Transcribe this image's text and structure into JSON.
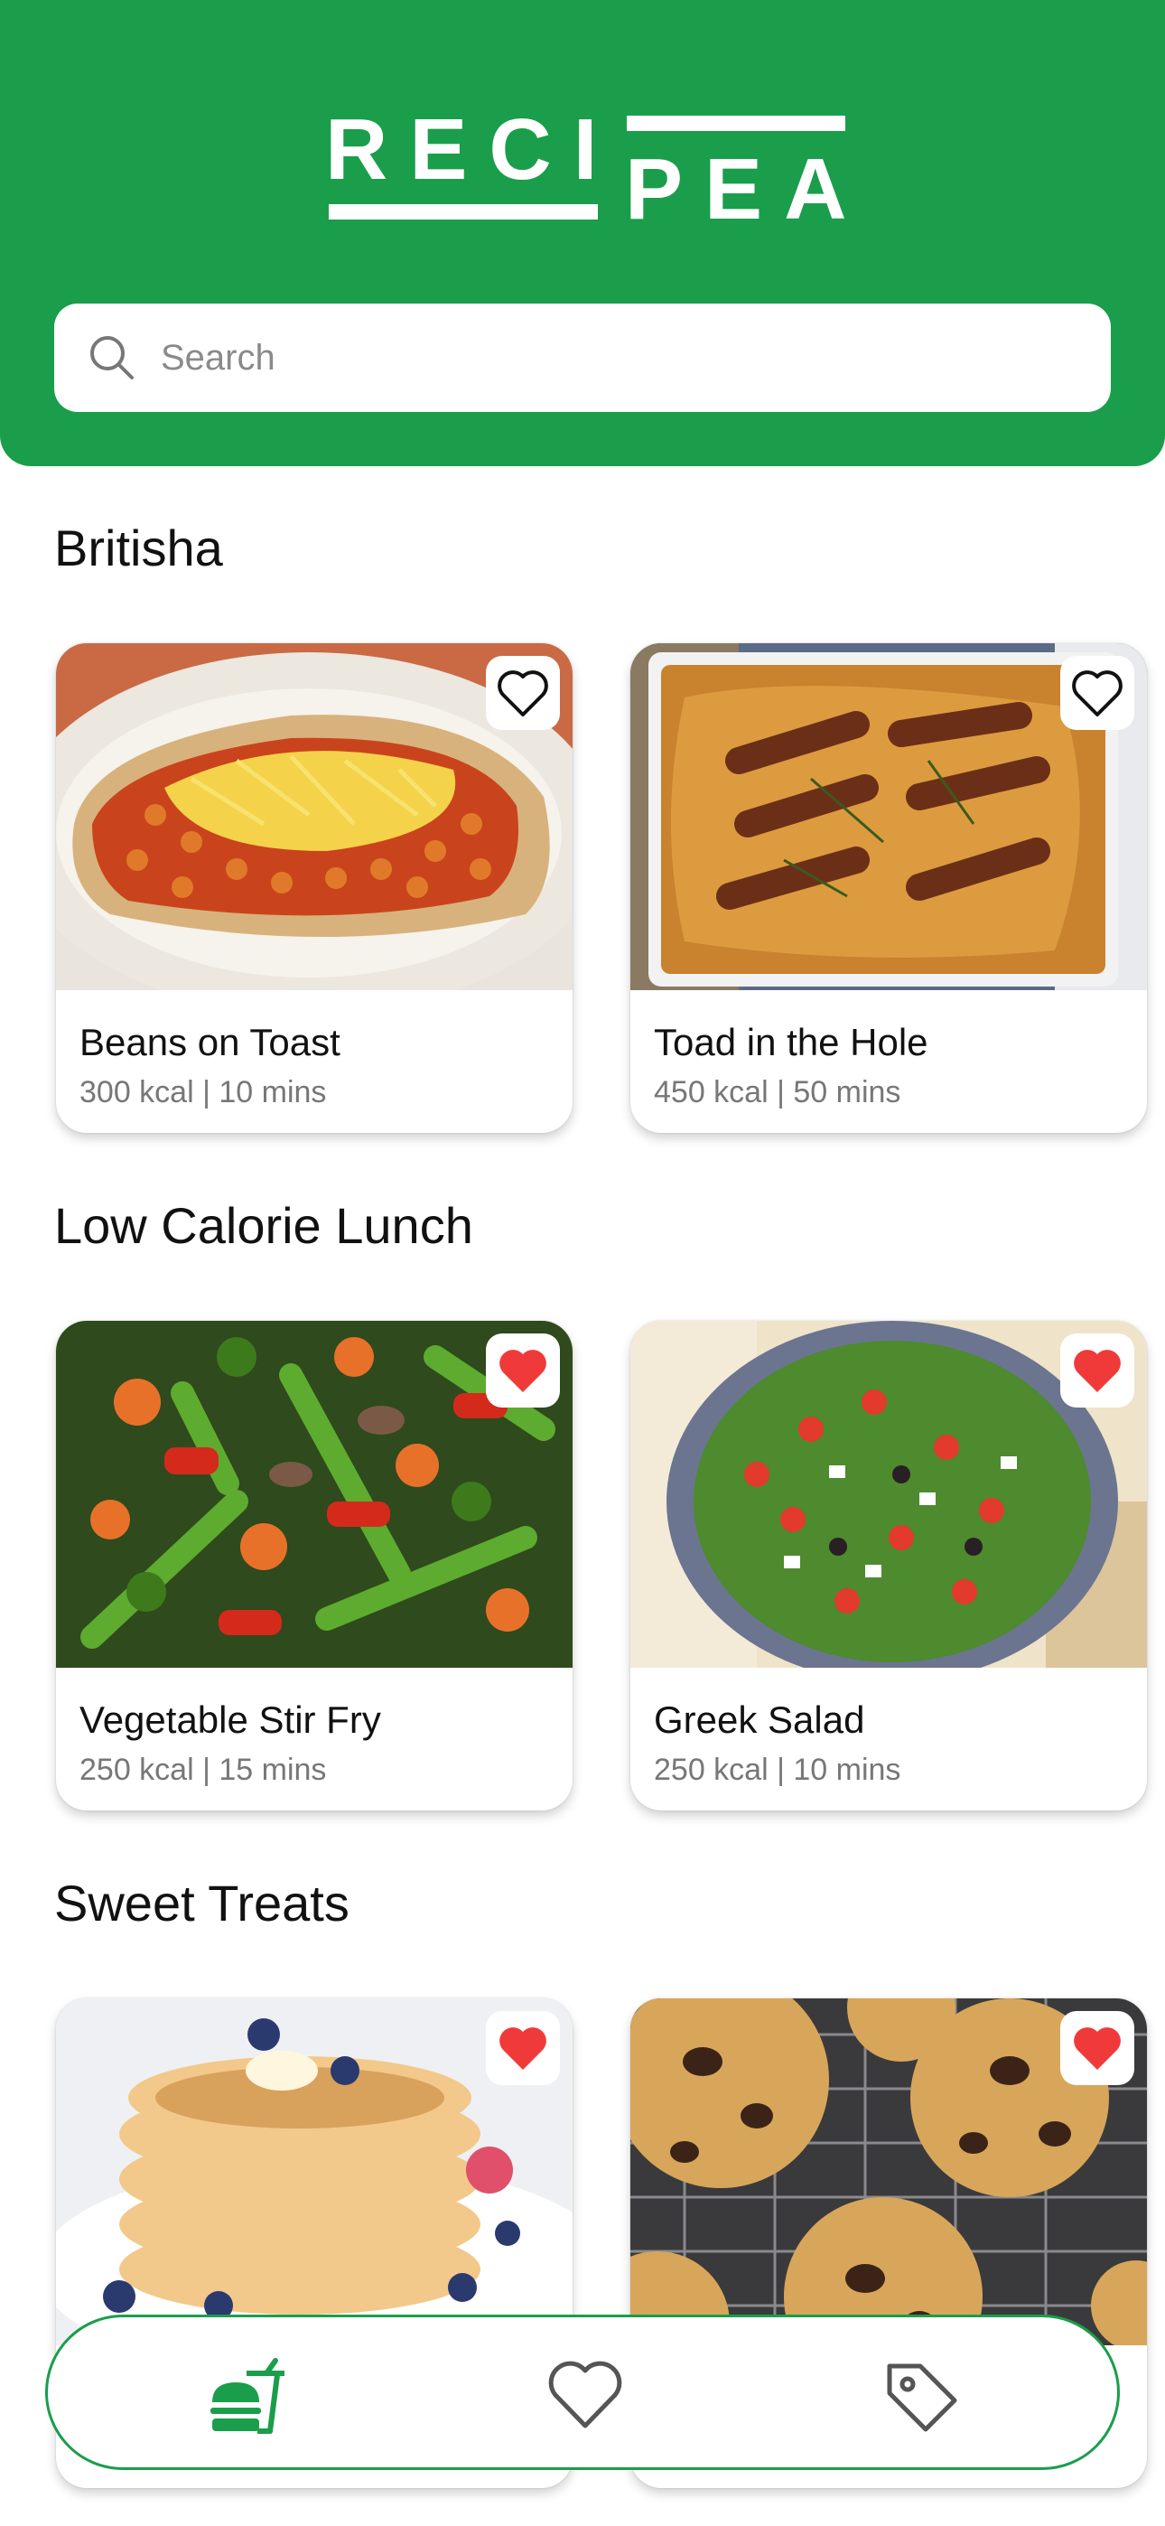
{
  "app": {
    "logo_left": "RECI",
    "logo_right": "PEA"
  },
  "search": {
    "placeholder": "Search",
    "value": ""
  },
  "sections": [
    {
      "title": "Britisha",
      "cards": [
        {
          "name": "Beans on Toast",
          "meta": "300 kcal | 10 mins",
          "favorited": false
        },
        {
          "name": "Toad in the Hole",
          "meta": "450 kcal | 50 mins",
          "favorited": false
        }
      ]
    },
    {
      "title": "Low Calorie Lunch",
      "cards": [
        {
          "name": "Vegetable Stir Fry",
          "meta": "250 kcal | 15 mins",
          "favorited": true
        },
        {
          "name": "Greek Salad",
          "meta": "250 kcal | 10 mins",
          "favorited": true
        }
      ]
    },
    {
      "title": "Sweet Treats",
      "cards": [
        {
          "name": "",
          "meta": "",
          "favorited": true
        },
        {
          "name": "",
          "meta": "",
          "favorited": true
        }
      ]
    }
  ],
  "nav": {
    "items": [
      {
        "icon": "fast-food-icon",
        "active": true
      },
      {
        "icon": "heart-icon",
        "active": false
      },
      {
        "icon": "tag-icon",
        "active": false
      }
    ]
  },
  "colors": {
    "brand": "#1a9e4b",
    "favorite": "#f03a3a",
    "muted": "#777777"
  }
}
